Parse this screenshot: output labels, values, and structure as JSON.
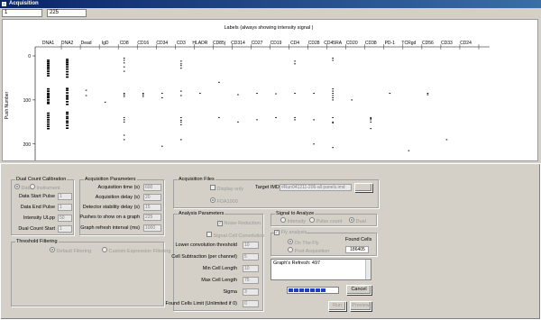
{
  "window": {
    "title": "Acquisition"
  },
  "toolbar": {
    "field1": "1",
    "field2": "225"
  },
  "chart_data": {
    "type": "scatter",
    "title": "Labels (always showing intensity signal )",
    "ylabel": "Push Number",
    "ylim": [
      0,
      225
    ],
    "yticks": [
      0,
      100,
      200
    ],
    "channels": [
      "DNA1",
      "DNA2",
      "Dead",
      "IgD",
      "CD8",
      "CD16",
      "CD34",
      "CD3",
      "HLADR",
      "CD85j",
      "CD314",
      "CD27",
      "CD19",
      "CD4",
      "CD28",
      "CD45RA",
      "CD20",
      "CD38",
      "PD-1",
      "TCRgd",
      "CD56",
      "CD33",
      "CD24"
    ],
    "series": [
      {
        "channel": "DNA1",
        "pushes": [
          10,
          14,
          18,
          22,
          26,
          30,
          35,
          40,
          45,
          75,
          80,
          85,
          88,
          92,
          95,
          100,
          105,
          108,
          130,
          135,
          140,
          145,
          150,
          155,
          160,
          165
        ]
      },
      {
        "channel": "DNA2",
        "pushes": [
          8,
          12,
          16,
          20,
          25,
          30,
          36,
          42,
          48,
          74,
          78,
          84,
          90,
          94,
          98,
          104,
          110,
          128,
          132,
          138,
          142,
          148,
          152,
          158,
          164
        ]
      },
      {
        "channel": "Dead",
        "pushes": [
          78,
          90
        ]
      },
      {
        "channel": "IgD",
        "pushes": [
          105
        ]
      },
      {
        "channel": "CD8",
        "pushes": [
          5,
          10,
          16,
          25,
          35,
          85,
          88,
          92,
          140,
          145,
          150,
          180,
          190
        ]
      },
      {
        "channel": "CD16",
        "pushes": [
          85,
          88,
          92
        ]
      },
      {
        "channel": "CD34",
        "pushes": [
          85,
          95,
          205
        ]
      },
      {
        "channel": "CD3",
        "pushes": [
          12,
          18,
          22,
          28,
          80,
          90,
          140,
          146,
          150,
          156,
          190
        ]
      },
      {
        "channel": "HLADR",
        "pushes": [
          85
        ]
      },
      {
        "channel": "CD85j",
        "pushes": [
          60,
          140
        ]
      },
      {
        "channel": "CD314",
        "pushes": [
          88,
          150
        ]
      },
      {
        "channel": "CD27",
        "pushes": [
          85,
          145
        ]
      },
      {
        "channel": "CD19",
        "pushes": [
          86,
          140
        ]
      },
      {
        "channel": "CD4",
        "pushes": [
          12,
          18,
          85,
          140,
          145
        ]
      },
      {
        "channel": "CD28",
        "pushes": [
          85,
          145,
          200
        ]
      },
      {
        "channel": "CD45RA",
        "pushes": [
          5,
          10,
          75,
          80,
          85,
          90,
          95,
          100,
          140,
          150,
          152,
          208
        ]
      },
      {
        "channel": "CD20",
        "pushes": [
          100
        ]
      },
      {
        "channel": "CD38",
        "pushes": [
          140,
          142,
          145,
          150,
          165
        ]
      },
      {
        "channel": "PD-1",
        "pushes": [
          85
        ]
      },
      {
        "channel": "TCRgd",
        "pushes": [
          215
        ]
      },
      {
        "channel": "CD56",
        "pushes": [
          85,
          88
        ]
      },
      {
        "channel": "CD33",
        "pushes": [
          190
        ]
      },
      {
        "channel": "CD24",
        "pushes": []
      }
    ]
  },
  "dual_count": {
    "title": "Dual Count Calibration",
    "radio_data": "Data",
    "radio_instrument": "Instrument",
    "rows": [
      {
        "label": "Data Start Pulse",
        "value": "1"
      },
      {
        "label": "Data End Pulse",
        "value": "1"
      },
      {
        "label": "Intensity ULpp",
        "value": "50"
      },
      {
        "label": "Dual Count Start",
        "value": "1"
      }
    ]
  },
  "acq_params": {
    "title": "Acquisition Parameters",
    "rows": [
      {
        "label": "Acquisition time (s)",
        "value": "600"
      },
      {
        "label": "Acquisition delay (s)",
        "value": "20"
      },
      {
        "label": "Detector stability delay (s)",
        "value": "15"
      },
      {
        "label": "Pushes to show on a graph",
        "value": "225"
      },
      {
        "label": "Graph refresh interval (ms)",
        "value": "1000"
      }
    ]
  },
  "threshold": {
    "title": "Threshold Filtering",
    "default": "Default Filtering",
    "custom": "Custom Expression Filtering"
  },
  "acq_files": {
    "title": "Acquisition Files",
    "display_only": "Display only",
    "target_label": "Target IMD",
    "target_value": "#Run041211-206-all panels.imd",
    "fda": "FDA1000"
  },
  "analysis": {
    "title": "Analysis Parameters",
    "noise": "Noise Reduction",
    "signal_conv": "Signal Cell Convolution",
    "rows": [
      {
        "label": "Lower convolution threshold",
        "value": "10"
      },
      {
        "label": "Cell Subtraction (per channel)",
        "value": "5"
      },
      {
        "label": "Min Cell Length",
        "value": "10"
      },
      {
        "label": "Max Cell Length",
        "value": "75"
      },
      {
        "label": "Sigma",
        "value": "3"
      },
      {
        "label": "Found Cells Limit (Unlimited if 0)",
        "value": "0"
      }
    ]
  },
  "signal": {
    "title": "Signal to Analyze",
    "intensity": "Intensity",
    "pulse": "Pulse count",
    "dual": "Dual"
  },
  "fly": {
    "title": "Fly analysis",
    "on_the_fly": "On The Fly",
    "post": "Post Acquisition",
    "found_label": "Found Cells",
    "found_value": "186405"
  },
  "log": {
    "line": "Graph's Refresh: 497"
  },
  "buttons": {
    "cancel": "Cancel",
    "run": "Run",
    "preview": "Preview"
  },
  "progress": {
    "blocks": 7
  }
}
